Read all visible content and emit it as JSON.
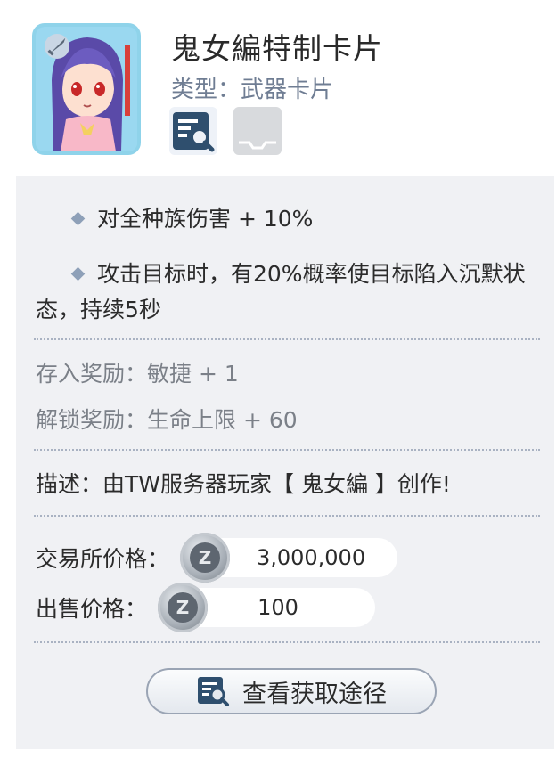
{
  "card": {
    "name": "鬼女編特制卡片",
    "type_label": "类型：武器卡片",
    "icons": [
      "view-details-icon",
      "empty-slot-icon"
    ],
    "portrait": "character-portrait",
    "sword_badge": "sword-icon"
  },
  "effects": [
    "对全种族伤害 + 10%",
    "攻击目标时，有20%概率使目标陷入沉默状态，持续5秒"
  ],
  "bonuses": {
    "deposit": "存入奖励：敏捷 + 1",
    "unlock": "解锁奖励：生命上限 + 60"
  },
  "description": "描述：由TW服务器玩家【 鬼女編 】创作!",
  "prices": {
    "exchange_label": "交易所价格：",
    "exchange_value": "3,000,000",
    "sell_label": "出售价格：",
    "sell_value": "100",
    "currency_icon": "zeny-coin-icon",
    "currency_glyph": "Z"
  },
  "actions": {
    "source_label": "查看获取途径"
  },
  "colors": {
    "accent": "#6f7d93",
    "panel": "#f0f1f4",
    "divider": "#a9b2c2"
  }
}
